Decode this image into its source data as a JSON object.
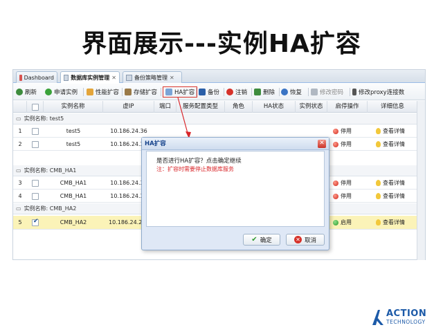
{
  "slide": {
    "title": "界面展示---实例HA扩容"
  },
  "tabs": [
    {
      "label": "Dashboard",
      "closable": false
    },
    {
      "label": "数据库实例管理",
      "closable": true
    },
    {
      "label": "备份策略管理",
      "closable": true
    }
  ],
  "toolbar": {
    "refresh": "刷新",
    "apply": "申请实例",
    "perf_expand": "性能扩容",
    "storage_expand": "存储扩容",
    "ha_expand": "HA扩容",
    "backup": "备份",
    "cancel": "注销",
    "delete": "删除",
    "restore": "恢复",
    "change_password": "修改密码",
    "change_proxy": "修改proxy连接数"
  },
  "columns": {
    "name": "实例名称",
    "vip": "虚IP",
    "port": "端口",
    "service_type": "服务配置类型",
    "role": "角色",
    "ha_status": "HA状态",
    "instance_status": "实例状态",
    "action": "启停操作",
    "detail": "详细信息"
  },
  "groups": [
    {
      "label": "实例名称: test5",
      "rows": [
        {
          "num": "1",
          "name": "test5",
          "vip": "10.186.24.36",
          "action": "停用",
          "action_color": "red",
          "detail": "查看详情",
          "checked": false
        },
        {
          "num": "2",
          "name": "test5",
          "vip": "10.186.24.37",
          "action": "停用",
          "action_color": "red",
          "detail": "查看详情",
          "checked": false
        }
      ]
    },
    {
      "label": "实例名称: CMB_HA1",
      "rows": [
        {
          "num": "3",
          "name": "CMB_HA1",
          "vip": "10.186.24.36",
          "action": "停用",
          "action_color": "red",
          "detail": "查看详情",
          "checked": false
        },
        {
          "num": "4",
          "name": "CMB_HA1",
          "vip": "10.186.24.37",
          "action": "停用",
          "action_color": "red",
          "detail": "查看详情",
          "checked": false
        }
      ]
    },
    {
      "label": "实例名称: CMB_HA2",
      "rows": [
        {
          "num": "5",
          "name": "CMB_HA2",
          "vip": "10.186.24.213(eth",
          "action": "启用",
          "action_color": "green",
          "detail": "查看详情",
          "checked": true
        }
      ]
    }
  ],
  "dialog": {
    "title": "HA扩容",
    "message": "是否进行HA扩容？点击确定继续",
    "warning": "注：扩容时需要停止数据库服务",
    "ok": "确定",
    "cancel": "取消"
  },
  "logo": {
    "main": "ACTION",
    "sub": "TECHNOLOGY"
  },
  "colors": {
    "accent": "#1c5aa8",
    "highlight_border": "#d9342b",
    "selected_row": "#fbf3b8",
    "warning_text": "#d9262a"
  }
}
